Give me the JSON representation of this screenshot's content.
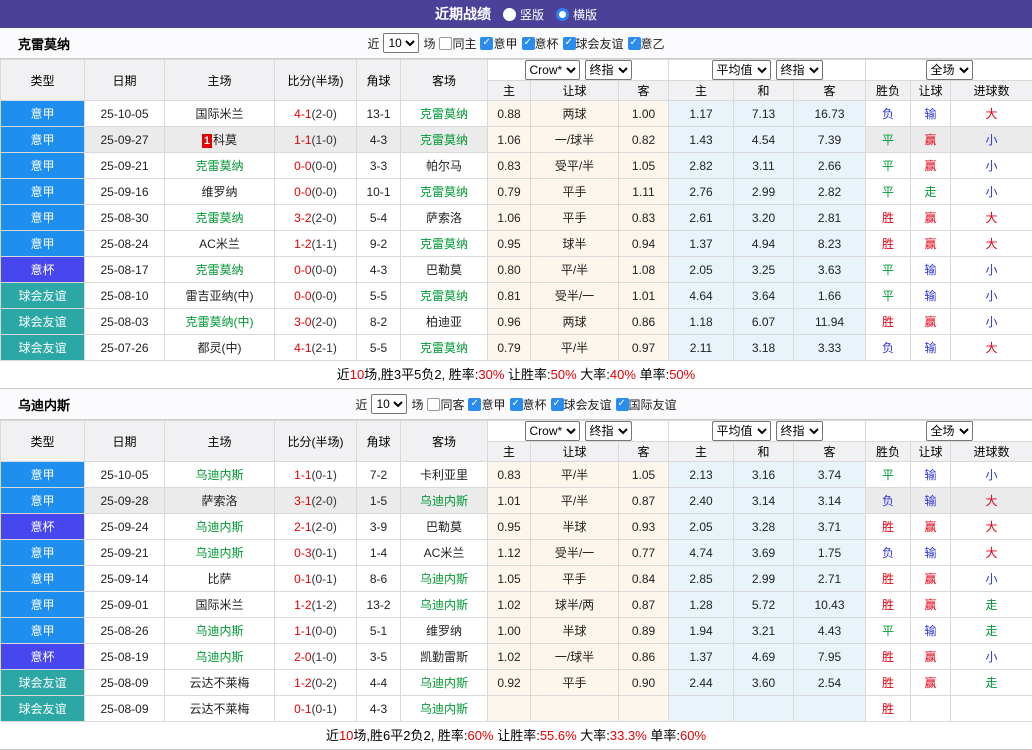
{
  "topbar": {
    "title": "近期战绩",
    "radios": [
      {
        "label": "竖版",
        "on": false
      },
      {
        "label": "横版",
        "on": true
      }
    ]
  },
  "labels": {
    "near": "近",
    "matches": "场"
  },
  "dropdowns": {
    "crow": "Crow*",
    "final1": "终指",
    "avg": "平均值",
    "final2": "终指",
    "full": "全场"
  },
  "table_header": {
    "cols": [
      "类型",
      "日期",
      "主场",
      "比分(半场)",
      "角球",
      "客场"
    ],
    "sub": [
      "主",
      "让球",
      "客",
      "主",
      "和",
      "客",
      "胜负",
      "让球",
      "进球数"
    ]
  },
  "colors": {
    "accent_purple": "#4b4199",
    "type_bg": {
      "意甲": "#1f8fef",
      "意杯": "#4847ef",
      "球会友谊": "#2ba8a5"
    },
    "result": {
      "胜": "#e60012",
      "平": "#009933",
      "负": "#2c35e0",
      "赢": "#e60012",
      "输": "#2c35e0",
      "走": "#009933",
      "大": "#e60012",
      "小": "#2c35e0"
    },
    "team_green": "#009933",
    "score_red": "#e60000"
  },
  "sections": [
    {
      "team": "克雷莫纳",
      "filter": {
        "count": "10",
        "checkboxes": [
          {
            "label": "同主",
            "on": false
          },
          {
            "label": "意甲",
            "on": true
          },
          {
            "label": "意杯",
            "on": true
          },
          {
            "label": "球会友谊",
            "on": true
          },
          {
            "label": "意乙",
            "on": true
          }
        ]
      },
      "rows": [
        {
          "type": "意甲",
          "date": "25-10-05",
          "home": "国际米兰",
          "home_green": false,
          "home_badge": "",
          "score": "4-1",
          "half": "(2-0)",
          "corners": "13-1",
          "away": "克雷莫纳",
          "away_green": true,
          "odds_home": "0.88",
          "handicap": "两球",
          "odds_away": "1.00",
          "avg_home": "1.17",
          "avg_draw": "7.13",
          "avg_away": "16.73",
          "res_wdl": "负",
          "res_handicap": "输",
          "res_goals": "大",
          "highlight": false
        },
        {
          "type": "意甲",
          "date": "25-09-27",
          "home": "科莫",
          "home_green": false,
          "home_badge": "1",
          "score": "1-1",
          "half": "(1-0)",
          "corners": "4-3",
          "away": "克雷莫纳",
          "away_green": true,
          "odds_home": "1.06",
          "handicap": "一/球半",
          "odds_away": "0.82",
          "avg_home": "1.43",
          "avg_draw": "4.54",
          "avg_away": "7.39",
          "res_wdl": "平",
          "res_handicap": "赢",
          "res_goals": "小",
          "highlight": true
        },
        {
          "type": "意甲",
          "date": "25-09-21",
          "home": "克雷莫纳",
          "home_green": true,
          "home_badge": "",
          "score": "0-0",
          "half": "(0-0)",
          "corners": "3-3",
          "away": "帕尔马",
          "away_green": false,
          "odds_home": "0.83",
          "handicap": "受平/半",
          "odds_away": "1.05",
          "avg_home": "2.82",
          "avg_draw": "3.11",
          "avg_away": "2.66",
          "res_wdl": "平",
          "res_handicap": "赢",
          "res_goals": "小",
          "highlight": false
        },
        {
          "type": "意甲",
          "date": "25-09-16",
          "home": "维罗纳",
          "home_green": false,
          "home_badge": "",
          "score": "0-0",
          "half": "(0-0)",
          "corners": "10-1",
          "away": "克雷莫纳",
          "away_green": true,
          "odds_home": "0.79",
          "handicap": "平手",
          "odds_away": "1.11",
          "avg_home": "2.76",
          "avg_draw": "2.99",
          "avg_away": "2.82",
          "res_wdl": "平",
          "res_handicap": "走",
          "res_goals": "小",
          "highlight": false
        },
        {
          "type": "意甲",
          "date": "25-08-30",
          "home": "克雷莫纳",
          "home_green": true,
          "home_badge": "",
          "score": "3-2",
          "half": "(2-0)",
          "corners": "5-4",
          "away": "萨索洛",
          "away_green": false,
          "odds_home": "1.06",
          "handicap": "平手",
          "odds_away": "0.83",
          "avg_home": "2.61",
          "avg_draw": "3.20",
          "avg_away": "2.81",
          "res_wdl": "胜",
          "res_handicap": "赢",
          "res_goals": "大",
          "highlight": false
        },
        {
          "type": "意甲",
          "date": "25-08-24",
          "home": "AC米兰",
          "home_green": false,
          "home_badge": "",
          "score": "1-2",
          "half": "(1-1)",
          "corners": "9-2",
          "away": "克雷莫纳",
          "away_green": true,
          "odds_home": "0.95",
          "handicap": "球半",
          "odds_away": "0.94",
          "avg_home": "1.37",
          "avg_draw": "4.94",
          "avg_away": "8.23",
          "res_wdl": "胜",
          "res_handicap": "赢",
          "res_goals": "大",
          "highlight": false
        },
        {
          "type": "意杯",
          "date": "25-08-17",
          "home": "克雷莫纳",
          "home_green": true,
          "home_badge": "",
          "score": "0-0",
          "half": "(0-0)",
          "corners": "4-3",
          "away": "巴勒莫",
          "away_green": false,
          "odds_home": "0.80",
          "handicap": "平/半",
          "odds_away": "1.08",
          "avg_home": "2.05",
          "avg_draw": "3.25",
          "avg_away": "3.63",
          "res_wdl": "平",
          "res_handicap": "输",
          "res_goals": "小",
          "highlight": false
        },
        {
          "type": "球会友谊",
          "date": "25-08-10",
          "home": "雷吉亚纳(中)",
          "home_green": false,
          "home_badge": "",
          "score": "0-0",
          "half": "(0-0)",
          "corners": "5-5",
          "away": "克雷莫纳",
          "away_green": true,
          "odds_home": "0.81",
          "handicap": "受半/一",
          "odds_away": "1.01",
          "avg_home": "4.64",
          "avg_draw": "3.64",
          "avg_away": "1.66",
          "res_wdl": "平",
          "res_handicap": "输",
          "res_goals": "小",
          "highlight": false
        },
        {
          "type": "球会友谊",
          "date": "25-08-03",
          "home": "克雷莫纳(中)",
          "home_green": true,
          "home_badge": "",
          "score": "3-0",
          "half": "(2-0)",
          "corners": "8-2",
          "away": "柏迪亚",
          "away_green": false,
          "odds_home": "0.96",
          "handicap": "两球",
          "odds_away": "0.86",
          "avg_home": "1.18",
          "avg_draw": "6.07",
          "avg_away": "11.94",
          "res_wdl": "胜",
          "res_handicap": "赢",
          "res_goals": "小",
          "highlight": false
        },
        {
          "type": "球会友谊",
          "date": "25-07-26",
          "home": "都灵(中)",
          "home_green": false,
          "home_badge": "",
          "score": "4-1",
          "half": "(2-1)",
          "corners": "5-5",
          "away": "克雷莫纳",
          "away_green": true,
          "odds_home": "0.79",
          "handicap": "平/半",
          "odds_away": "0.97",
          "avg_home": "2.11",
          "avg_draw": "3.18",
          "avg_away": "3.33",
          "res_wdl": "负",
          "res_handicap": "输",
          "res_goals": "大",
          "highlight": false
        }
      ],
      "summary": [
        {
          "text": "近",
          "red": false
        },
        {
          "text": "10",
          "red": true
        },
        {
          "text": "场,胜3平5负2, 胜率:",
          "red": false
        },
        {
          "text": "30%",
          "red": true
        },
        {
          "text": " 让胜率:",
          "red": false
        },
        {
          "text": "50%",
          "red": true
        },
        {
          "text": " 大率:",
          "red": false
        },
        {
          "text": "40%",
          "red": true
        },
        {
          "text": " 单率:",
          "red": false
        },
        {
          "text": "50%",
          "red": true
        }
      ]
    },
    {
      "team": "乌迪内斯",
      "filter": {
        "count": "10",
        "checkboxes": [
          {
            "label": "同客",
            "on": false
          },
          {
            "label": "意甲",
            "on": true
          },
          {
            "label": "意杯",
            "on": true
          },
          {
            "label": "球会友谊",
            "on": true
          },
          {
            "label": "国际友谊",
            "on": true
          }
        ]
      },
      "rows": [
        {
          "type": "意甲",
          "date": "25-10-05",
          "home": "乌迪内斯",
          "home_green": true,
          "home_badge": "",
          "score": "1-1",
          "half": "(0-1)",
          "corners": "7-2",
          "away": "卡利亚里",
          "away_green": false,
          "odds_home": "0.83",
          "handicap": "平/半",
          "odds_away": "1.05",
          "avg_home": "2.13",
          "avg_draw": "3.16",
          "avg_away": "3.74",
          "res_wdl": "平",
          "res_handicap": "输",
          "res_goals": "小",
          "highlight": false
        },
        {
          "type": "意甲",
          "date": "25-09-28",
          "home": "萨索洛",
          "home_green": false,
          "home_badge": "",
          "score": "3-1",
          "half": "(2-0)",
          "corners": "1-5",
          "away": "乌迪内斯",
          "away_green": true,
          "odds_home": "1.01",
          "handicap": "平/半",
          "odds_away": "0.87",
          "avg_home": "2.40",
          "avg_draw": "3.14",
          "avg_away": "3.14",
          "res_wdl": "负",
          "res_handicap": "输",
          "res_goals": "大",
          "highlight": true
        },
        {
          "type": "意杯",
          "date": "25-09-24",
          "home": "乌迪内斯",
          "home_green": true,
          "home_badge": "",
          "score": "2-1",
          "half": "(2-0)",
          "corners": "3-9",
          "away": "巴勒莫",
          "away_green": false,
          "odds_home": "0.95",
          "handicap": "半球",
          "odds_away": "0.93",
          "avg_home": "2.05",
          "avg_draw": "3.28",
          "avg_away": "3.71",
          "res_wdl": "胜",
          "res_handicap": "赢",
          "res_goals": "大",
          "highlight": false
        },
        {
          "type": "意甲",
          "date": "25-09-21",
          "home": "乌迪内斯",
          "home_green": true,
          "home_badge": "",
          "score": "0-3",
          "half": "(0-1)",
          "corners": "1-4",
          "away": "AC米兰",
          "away_green": false,
          "odds_home": "1.12",
          "handicap": "受半/一",
          "odds_away": "0.77",
          "avg_home": "4.74",
          "avg_draw": "3.69",
          "avg_away": "1.75",
          "res_wdl": "负",
          "res_handicap": "输",
          "res_goals": "大",
          "highlight": false
        },
        {
          "type": "意甲",
          "date": "25-09-14",
          "home": "比萨",
          "home_green": false,
          "home_badge": "",
          "score": "0-1",
          "half": "(0-1)",
          "corners": "8-6",
          "away": "乌迪内斯",
          "away_green": true,
          "odds_home": "1.05",
          "handicap": "平手",
          "odds_away": "0.84",
          "avg_home": "2.85",
          "avg_draw": "2.99",
          "avg_away": "2.71",
          "res_wdl": "胜",
          "res_handicap": "赢",
          "res_goals": "小",
          "highlight": false
        },
        {
          "type": "意甲",
          "date": "25-09-01",
          "home": "国际米兰",
          "home_green": false,
          "home_badge": "",
          "score": "1-2",
          "half": "(1-2)",
          "corners": "13-2",
          "away": "乌迪内斯",
          "away_green": true,
          "odds_home": "1.02",
          "handicap": "球半/两",
          "odds_away": "0.87",
          "avg_home": "1.28",
          "avg_draw": "5.72",
          "avg_away": "10.43",
          "res_wdl": "胜",
          "res_handicap": "赢",
          "res_goals": "走",
          "highlight": false
        },
        {
          "type": "意甲",
          "date": "25-08-26",
          "home": "乌迪内斯",
          "home_green": true,
          "home_badge": "",
          "score": "1-1",
          "half": "(0-0)",
          "corners": "5-1",
          "away": "维罗纳",
          "away_green": false,
          "odds_home": "1.00",
          "handicap": "半球",
          "odds_away": "0.89",
          "avg_home": "1.94",
          "avg_draw": "3.21",
          "avg_away": "4.43",
          "res_wdl": "平",
          "res_handicap": "输",
          "res_goals": "走",
          "highlight": false
        },
        {
          "type": "意杯",
          "date": "25-08-19",
          "home": "乌迪内斯",
          "home_green": true,
          "home_badge": "",
          "score": "2-0",
          "half": "(1-0)",
          "corners": "3-5",
          "away": "凯勤雷斯",
          "away_green": false,
          "odds_home": "1.02",
          "handicap": "一/球半",
          "odds_away": "0.86",
          "avg_home": "1.37",
          "avg_draw": "4.69",
          "avg_away": "7.95",
          "res_wdl": "胜",
          "res_handicap": "赢",
          "res_goals": "小",
          "highlight": false
        },
        {
          "type": "球会友谊",
          "date": "25-08-09",
          "home": "云达不莱梅",
          "home_green": false,
          "home_badge": "",
          "score": "1-2",
          "half": "(0-2)",
          "corners": "4-4",
          "away": "乌迪内斯",
          "away_green": true,
          "odds_home": "0.92",
          "handicap": "平手",
          "odds_away": "0.90",
          "avg_home": "2.44",
          "avg_draw": "3.60",
          "avg_away": "2.54",
          "res_wdl": "胜",
          "res_handicap": "赢",
          "res_goals": "走",
          "highlight": false
        },
        {
          "type": "球会友谊",
          "date": "25-08-09",
          "home": "云达不莱梅",
          "home_green": false,
          "home_badge": "",
          "score": "0-1",
          "half": "(0-1)",
          "corners": "4-3",
          "away": "乌迪内斯",
          "away_green": true,
          "odds_home": "",
          "handicap": "",
          "odds_away": "",
          "avg_home": "",
          "avg_draw": "",
          "avg_away": "",
          "res_wdl": "胜",
          "res_handicap": "",
          "res_goals": "",
          "highlight": false
        }
      ],
      "summary": [
        {
          "text": "近",
          "red": false
        },
        {
          "text": "10",
          "red": true
        },
        {
          "text": "场,胜6平2负2, 胜率:",
          "red": false
        },
        {
          "text": "60%",
          "red": true
        },
        {
          "text": " 让胜率:",
          "red": false
        },
        {
          "text": "55.6%",
          "red": true
        },
        {
          "text": " 大率:",
          "red": false
        },
        {
          "text": "33.3%",
          "red": true
        },
        {
          "text": " 单率:",
          "red": false
        },
        {
          "text": "60%",
          "red": true
        }
      ]
    }
  ]
}
